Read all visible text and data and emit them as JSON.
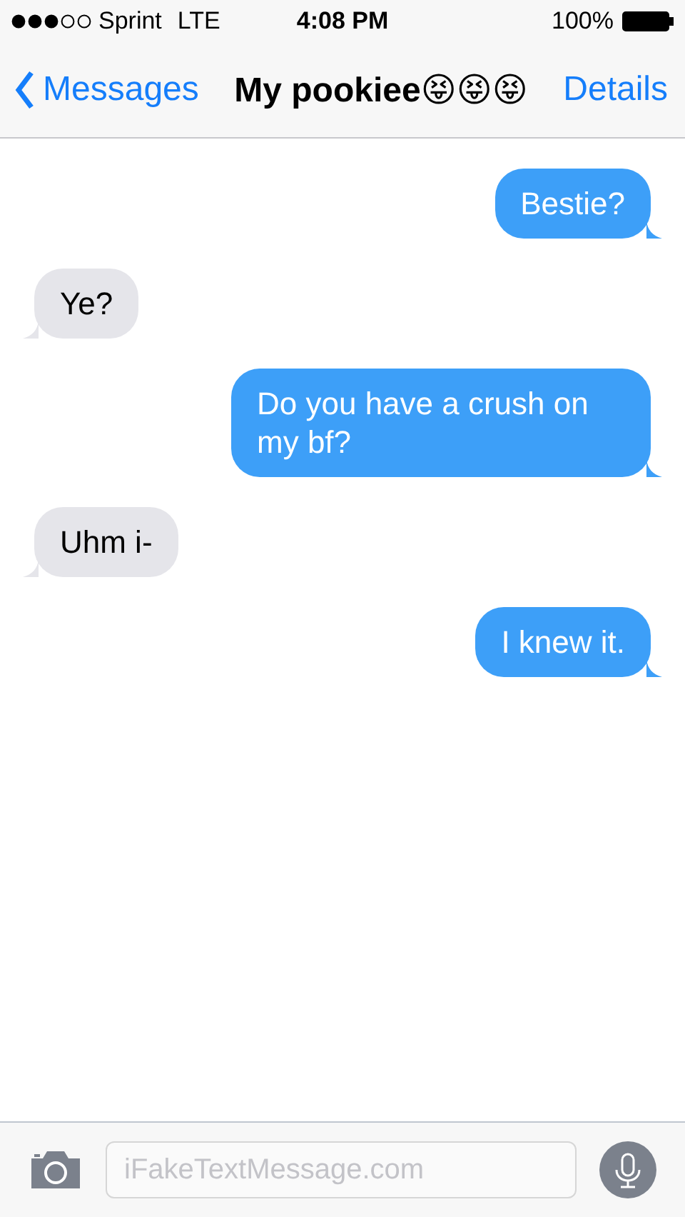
{
  "status_bar": {
    "carrier": "Sprint",
    "network": "LTE",
    "time": "4:08 PM",
    "battery": "100%"
  },
  "nav": {
    "back": "Messages",
    "title": "My pookiee😝😝😝",
    "action": "Details"
  },
  "messages": [
    {
      "text": "Bestie?",
      "sent": true
    },
    {
      "text": "Ye?",
      "sent": false
    },
    {
      "text": "Do you have a crush on my bf?",
      "sent": true
    },
    {
      "text": "Uhm i-",
      "sent": false
    },
    {
      "text": "I knew it.",
      "sent": true
    }
  ],
  "composer": {
    "placeholder": "iFakeTextMessage.com"
  }
}
